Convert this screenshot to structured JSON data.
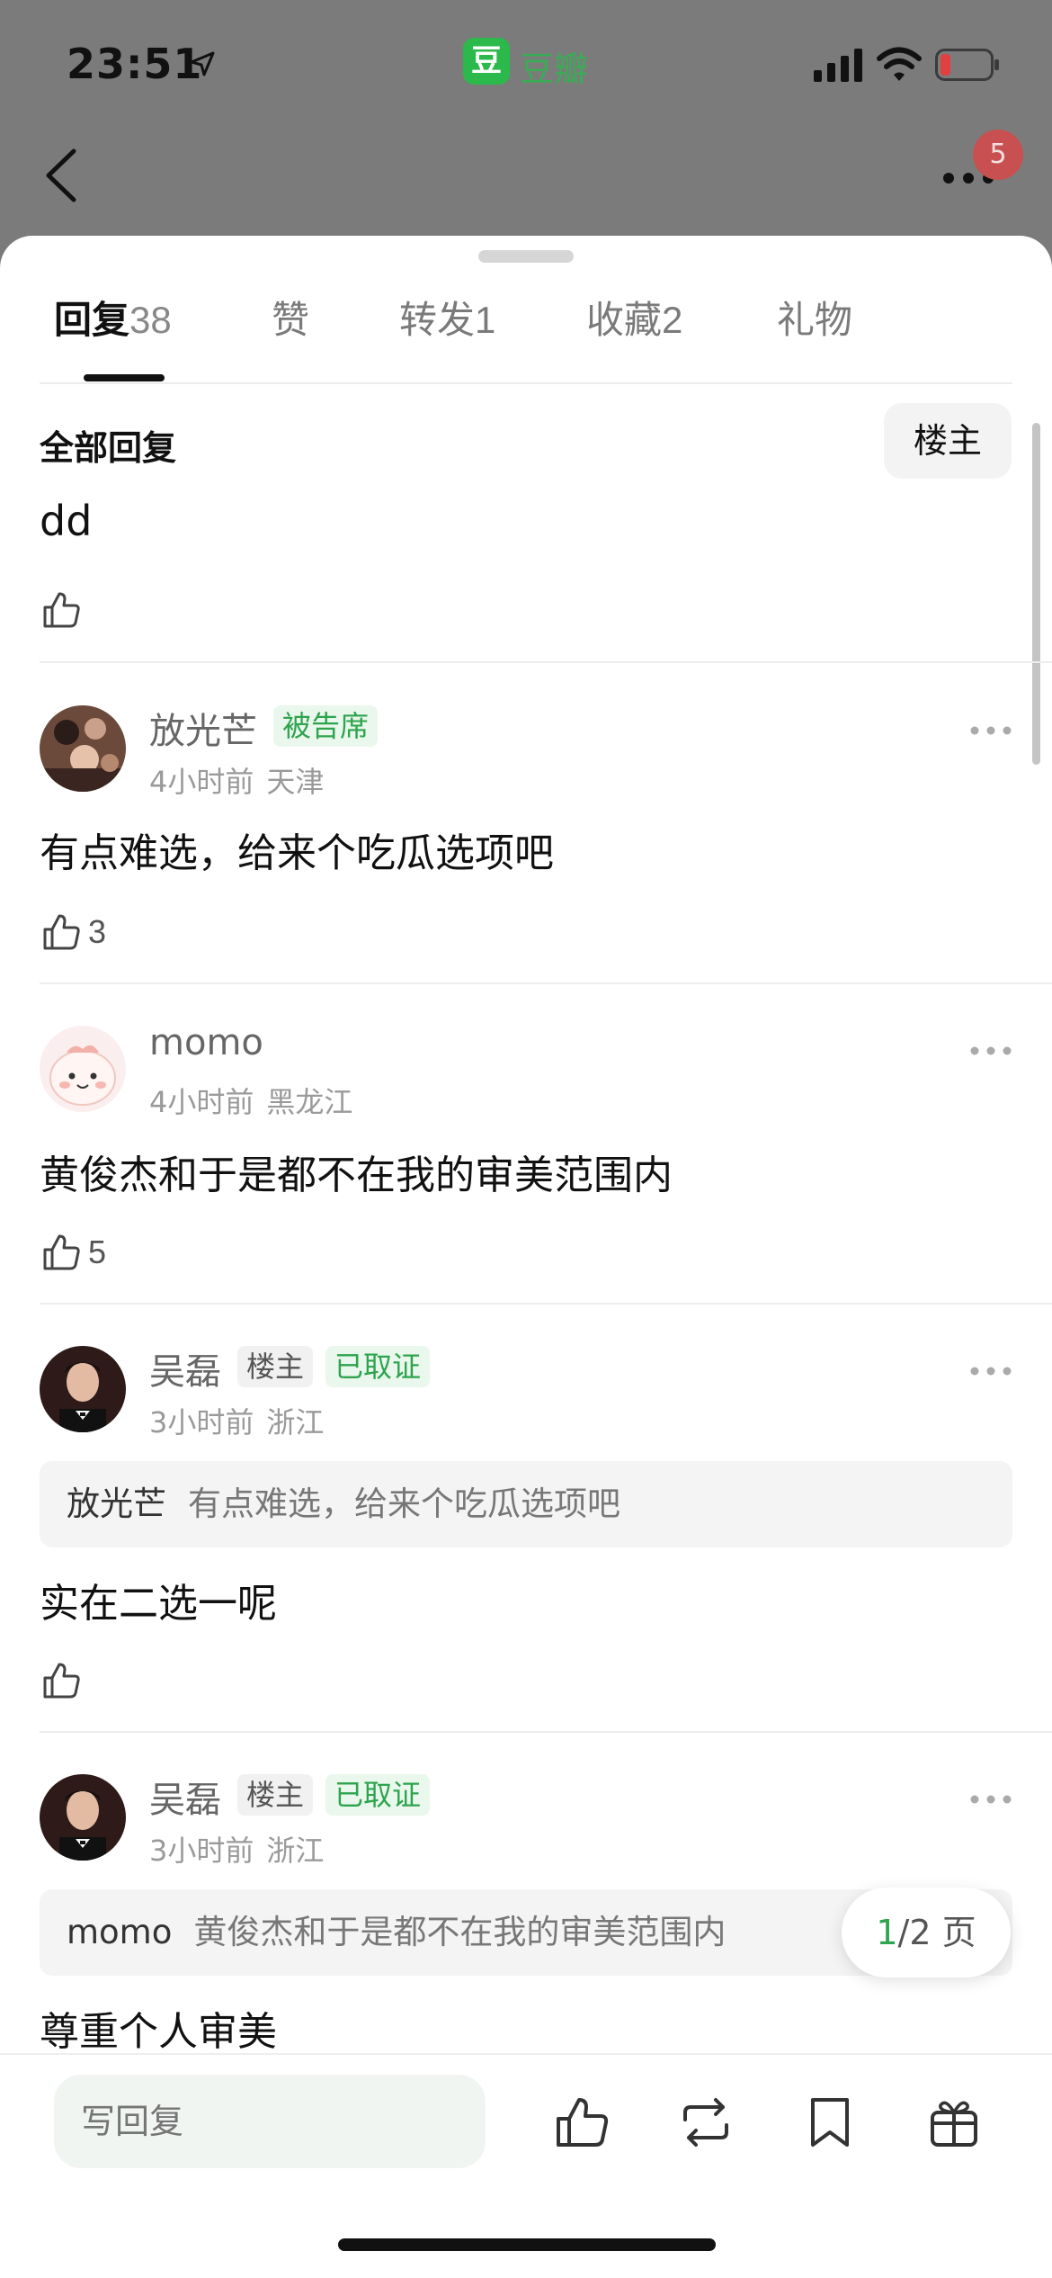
{
  "status_bar": {
    "time": "23:51",
    "app_badge": "豆",
    "app_name": "豆瓣",
    "battery_color": "#e04040"
  },
  "nav": {
    "notification_count": "5"
  },
  "tabs": [
    {
      "label": "回复",
      "count": "38"
    },
    {
      "label": "赞",
      "count": ""
    },
    {
      "label": "转发",
      "count": "1"
    },
    {
      "label": "收藏",
      "count": "2"
    },
    {
      "label": "礼物",
      "count": ""
    }
  ],
  "filter": {
    "label": "全部回复",
    "op_button": "楼主"
  },
  "top_comment": {
    "text": "dd"
  },
  "comments": [
    {
      "name": "放光芒",
      "tags": [
        "被告席"
      ],
      "time": "4小时前",
      "place": "天津",
      "text": "有点难选，给来个吃瓜选项吧",
      "likes": "3"
    },
    {
      "name": "momo",
      "tags": [],
      "time": "4小时前",
      "place": "黑龙江",
      "text": "黄俊杰和于是都不在我的审美范围内",
      "likes": "5"
    },
    {
      "name": "吴磊",
      "tags": [
        "楼主",
        "已取证"
      ],
      "time": "3小时前",
      "place": "浙江",
      "quote_name": "放光芒",
      "quote_text": "有点难选，给来个吃瓜选项吧",
      "text": "实在二选一呢",
      "likes": ""
    },
    {
      "name": "吴磊",
      "tags": [
        "楼主",
        "已取证"
      ],
      "time": "3小时前",
      "place": "浙江",
      "quote_name": "momo",
      "quote_text": "黄俊杰和于是都不在我的审美范围内",
      "text": "尊重个人审美",
      "likes": ""
    }
  ],
  "pager": {
    "current": "1",
    "total": "/2",
    "unit": "页"
  },
  "bottom_bar": {
    "reply_placeholder": "写回复"
  },
  "colors": {
    "accent_green": "#2da44e",
    "overlay_gray": "#7b7b7b"
  }
}
